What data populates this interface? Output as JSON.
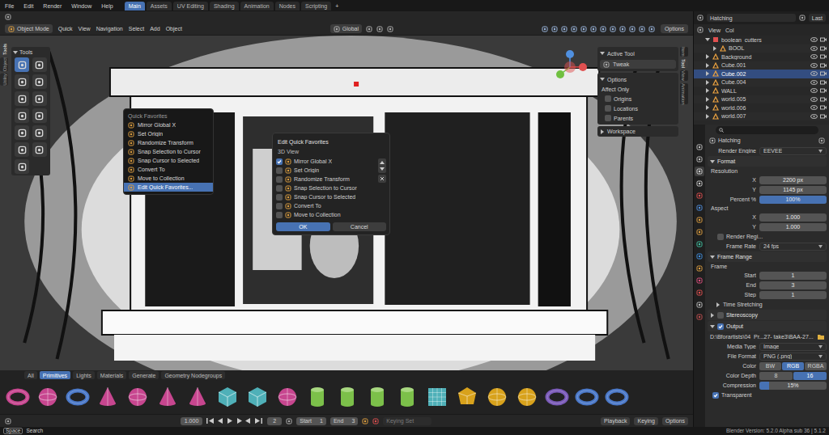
{
  "menu_bar": {
    "menus": [
      "File",
      "Edit",
      "Render",
      "Window",
      "Help"
    ],
    "workspaces": [
      {
        "label": "Main",
        "selected": true
      },
      {
        "label": "Assets",
        "selected": false
      },
      {
        "label": "UV Editing",
        "selected": false
      },
      {
        "label": "Shading",
        "selected": false
      },
      {
        "label": "Animation",
        "selected": false
      },
      {
        "label": "Nodes",
        "selected": false
      },
      {
        "label": "Scripting",
        "selected": false
      }
    ],
    "add_workspace": "+"
  },
  "scene_bar": {
    "scene": "Hatching",
    "layer": "Last"
  },
  "viewport_header": {
    "mode": "Object Mode",
    "menus": [
      "Quick",
      "View",
      "Navigation",
      "Select",
      "Add",
      "Object"
    ],
    "orientation": "Global",
    "options": "Options"
  },
  "toolbar": {
    "title": "Tools",
    "side_tabs": [
      {
        "label": "Tools",
        "selected": true
      },
      {
        "label": "Object",
        "selected": false
      },
      {
        "label": "Utility",
        "selected": false
      }
    ],
    "tools": [
      {
        "selected": true
      },
      {
        "selected": false
      },
      {
        "selected": false
      },
      {
        "selected": false
      },
      {
        "selected": false
      },
      {
        "selected": false
      },
      {
        "selected": false
      },
      {
        "selected": false
      },
      {
        "selected": false
      },
      {
        "selected": false
      },
      {
        "selected": false
      },
      {
        "selected": false
      },
      {
        "selected": false
      }
    ]
  },
  "quick_favorites": {
    "title": "Quick Favorites",
    "items": [
      {
        "label": "Mirror Global X",
        "highlighted": false
      },
      {
        "label": "Set Origin",
        "highlighted": false
      },
      {
        "label": "Randomize Transform",
        "highlighted": false
      },
      {
        "label": "Snap Selection to Cursor",
        "highlighted": false
      },
      {
        "label": "Snap Cursor to Selected",
        "highlighted": false
      },
      {
        "label": "Convert To",
        "highlighted": false
      },
      {
        "label": "Move to Collection",
        "highlighted": false
      },
      {
        "label": "Edit Quick Favorites...",
        "highlighted": true
      }
    ]
  },
  "edit_dialog": {
    "title": "Edit Quick Favorites",
    "section": "3D View",
    "items": [
      {
        "label": "Mirror Global X",
        "checked": true
      },
      {
        "label": "Set Origin",
        "checked": false
      },
      {
        "label": "Randomize Transform",
        "checked": false
      },
      {
        "label": "Snap Selection to Cursor",
        "checked": false
      },
      {
        "label": "Snap Cursor to Selected",
        "checked": false
      },
      {
        "label": "Convert To",
        "checked": false
      },
      {
        "label": "Move to Collection",
        "checked": false
      }
    ],
    "buttons": [
      {
        "label": "OK",
        "default": true
      },
      {
        "label": "Cancel",
        "default": false
      }
    ]
  },
  "n_panel": {
    "tabs": [
      {
        "label": "Item",
        "selected": false
      },
      {
        "label": "Tool",
        "selected": true
      },
      {
        "label": "View",
        "selected": false
      },
      {
        "label": "Animation",
        "selected": false
      }
    ],
    "active_tool": {
      "title": "Active Tool",
      "expanded": true,
      "tool": "Tweak"
    },
    "options": {
      "title": "Options",
      "expanded": true,
      "affect_only": "Affect Only",
      "items": [
        {
          "label": "Origins",
          "checked": false
        },
        {
          "label": "Locations",
          "checked": false
        },
        {
          "label": "Parents",
          "checked": false
        }
      ]
    },
    "workspace": {
      "title": "Workspace",
      "expanded": false
    }
  },
  "outliner": {
    "header": [
      "View",
      "Col"
    ],
    "items": [
      {
        "name": "boolean_cutters",
        "depth": 1,
        "kind": "collection",
        "expanded": true,
        "selected": false,
        "color": "#e05050"
      },
      {
        "name": "BOOL",
        "depth": 2,
        "kind": "object",
        "expanded": false,
        "selected": false,
        "color": "#e8a040"
      },
      {
        "name": "Background",
        "depth": 1,
        "kind": "object",
        "expanded": false,
        "selected": false,
        "color": "#e8a040"
      },
      {
        "name": "Cube.001",
        "depth": 1,
        "kind": "object",
        "expanded": false,
        "selected": false,
        "color": "#e8a040"
      },
      {
        "name": "Cube.002",
        "depth": 1,
        "kind": "object",
        "expanded": false,
        "selected": true,
        "color": "#e8a040"
      },
      {
        "name": "Cube.004",
        "depth": 1,
        "kind": "object",
        "expanded": false,
        "selected": false,
        "color": "#e8a040"
      },
      {
        "name": "WALL",
        "depth": 1,
        "kind": "object",
        "expanded": false,
        "selected": false,
        "color": "#e8a040"
      },
      {
        "name": "world.005",
        "depth": 1,
        "kind": "object",
        "expanded": false,
        "selected": false,
        "color": "#e8a040"
      },
      {
        "name": "world.006",
        "depth": 1,
        "kind": "object",
        "expanded": false,
        "selected": false,
        "color": "#e8a040"
      },
      {
        "name": "world.007",
        "depth": 1,
        "kind": "object",
        "expanded": false,
        "selected": false,
        "color": "#e8a040"
      }
    ]
  },
  "properties": {
    "tabs": [
      {
        "selected": false,
        "color": "#c0c0c0"
      },
      {
        "selected": false,
        "color": "#c0c0c0"
      },
      {
        "selected": true,
        "color": "#d0d0d0"
      },
      {
        "selected": false,
        "color": "#d0d0d0"
      },
      {
        "selected": false,
        "color": "#e05050"
      },
      {
        "selected": false,
        "color": "#5090e0"
      },
      {
        "selected": false,
        "color": "#e0a040"
      },
      {
        "selected": false,
        "color": "#e0a040"
      },
      {
        "selected": false,
        "color": "#40c0a0"
      },
      {
        "selected": false,
        "color": "#4090e0"
      },
      {
        "selected": false,
        "color": "#e0a040"
      },
      {
        "selected": false,
        "color": "#e05080"
      },
      {
        "selected": false,
        "color": "#e05050"
      },
      {
        "selected": false,
        "color": "#c0c0c0"
      },
      {
        "selected": false,
        "color": "#c05050"
      }
    ],
    "context": "Hatching",
    "render_engine": {
      "label": "Render Engine",
      "value": "EEVEE"
    },
    "format": {
      "title": "Format",
      "expanded": true,
      "resolution_label": "Resolution",
      "resolution": [
        {
          "label": "X",
          "value": "2200 px"
        },
        {
          "label": "Y",
          "value": "1145 px"
        }
      ],
      "percent": {
        "label": "Percent %",
        "value": "100%",
        "level": 1
      },
      "aspect_label": "Aspect",
      "aspect": [
        {
          "label": "X",
          "value": "1.000"
        },
        {
          "label": "Y",
          "value": "1.000"
        }
      ],
      "render_region": {
        "label": "Render Regi...",
        "checked": false
      },
      "frame_rate": {
        "label": "Frame Rate",
        "value": "24 fps"
      }
    },
    "frame_range": {
      "title": "Frame Range",
      "expanded": true,
      "frame_label": "Frame",
      "fields": [
        {
          "label": "Start",
          "value": "1"
        },
        {
          "label": "End",
          "value": "3"
        },
        {
          "label": "Step",
          "value": "1"
        }
      ],
      "time_stretching": {
        "title": "Time Stretching",
        "expanded": false
      }
    },
    "stereoscopy": {
      "title": "Stereoscopy",
      "expanded": false,
      "checked": false
    },
    "output": {
      "title": "Output",
      "expanded": true,
      "checked": true,
      "path": "D:\\Bforartists\\04_Pr...27- take3\\BAA-27...",
      "media_type": {
        "label": "Media Type",
        "value": "Image"
      },
      "file_format": {
        "label": "File Format",
        "value": "PNG (.png)"
      },
      "color": {
        "label": "Color",
        "options": [
          {
            "label": "BW",
            "selected": false
          },
          {
            "label": "RGB",
            "selected": true
          },
          {
            "label": "RGBA",
            "selected": false
          }
        ]
      },
      "color_depth": {
        "label": "Color Depth",
        "options": [
          {
            "label": "8",
            "selected": false
          },
          {
            "label": "16",
            "selected": true
          }
        ]
      },
      "compression": {
        "label": "Compression",
        "value": "15%",
        "level": 0.15
      },
      "transparent": {
        "label": "Transparent",
        "checked": true
      }
    }
  },
  "asset_shelf": {
    "tabs": [
      {
        "label": "All",
        "selected": false
      },
      {
        "label": "Primitives",
        "selected": true
      },
      {
        "label": "Lights",
        "selected": false
      },
      {
        "label": "Materials",
        "selected": false
      },
      {
        "label": "Generate",
        "selected": false
      },
      {
        "label": "Geometry Nodegroups",
        "selected": false
      }
    ],
    "assets": [
      {
        "kind": "torus",
        "color": "#c7468f"
      },
      {
        "kind": "sphere",
        "color": "#c7468f"
      },
      {
        "kind": "torus",
        "color": "#4a78c8"
      },
      {
        "kind": "cone",
        "color": "#c7468f"
      },
      {
        "kind": "sphere",
        "color": "#c7468f"
      },
      {
        "kind": "cone",
        "color": "#c7468f"
      },
      {
        "kind": "cone",
        "color": "#c7468f"
      },
      {
        "kind": "cube",
        "color": "#4fb0b8"
      },
      {
        "kind": "cube",
        "color": "#4fb0b8"
      },
      {
        "kind": "sphere",
        "color": "#c7468f"
      },
      {
        "kind": "cylinder",
        "color": "#7cc04a"
      },
      {
        "kind": "cylinder",
        "color": "#7cc04a"
      },
      {
        "kind": "cylinder",
        "color": "#7cc04a"
      },
      {
        "kind": "cylinder",
        "color": "#7cc04a"
      },
      {
        "kind": "grid",
        "color": "#4fb0b8"
      },
      {
        "kind": "ico",
        "color": "#d8a21c"
      },
      {
        "kind": "sphere",
        "color": "#d8a21c"
      },
      {
        "kind": "sphere",
        "color": "#d8a21c"
      },
      {
        "kind": "torus",
        "color": "#7a5ab8"
      },
      {
        "kind": "torus",
        "color": "#4a78c8"
      },
      {
        "kind": "torus",
        "color": "#4a78c8"
      }
    ]
  },
  "timeline": {
    "time": "1.000",
    "current_frame": "2",
    "start": {
      "label": "Start",
      "value": "1"
    },
    "end": {
      "label": "End",
      "value": "3"
    },
    "keying_set": "Keying Set",
    "menus": [
      "Playback",
      "Keying"
    ],
    "options": "Options"
  },
  "status_bar": {
    "key": "Space",
    "action": "Search",
    "version": "Blender Version: 5.2.0 Alpha sub 36 | 5.1.2"
  }
}
